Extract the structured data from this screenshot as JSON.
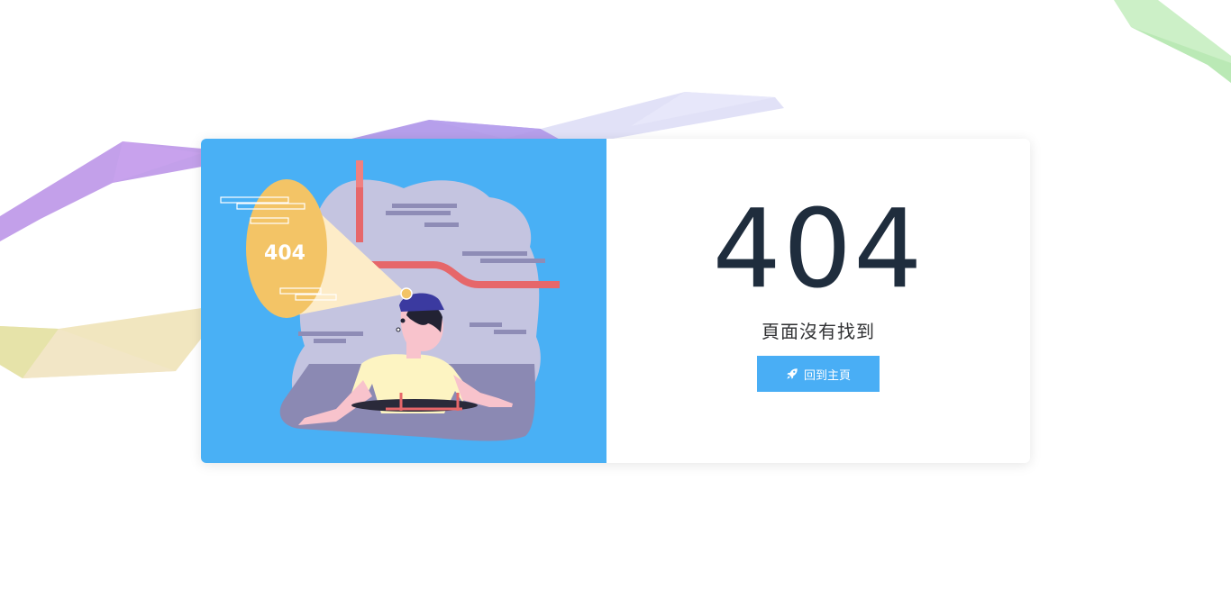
{
  "error": {
    "code": "404",
    "message": "頁面沒有找到"
  },
  "illustration": {
    "spotlight_text": "404"
  },
  "actions": {
    "home_button_label": "回到主頁",
    "home_button_icon": "rocket-icon"
  },
  "colors": {
    "illustration_bg": "#49b0f5",
    "accent": "#49aef5",
    "code_text": "#1f2d3d"
  }
}
